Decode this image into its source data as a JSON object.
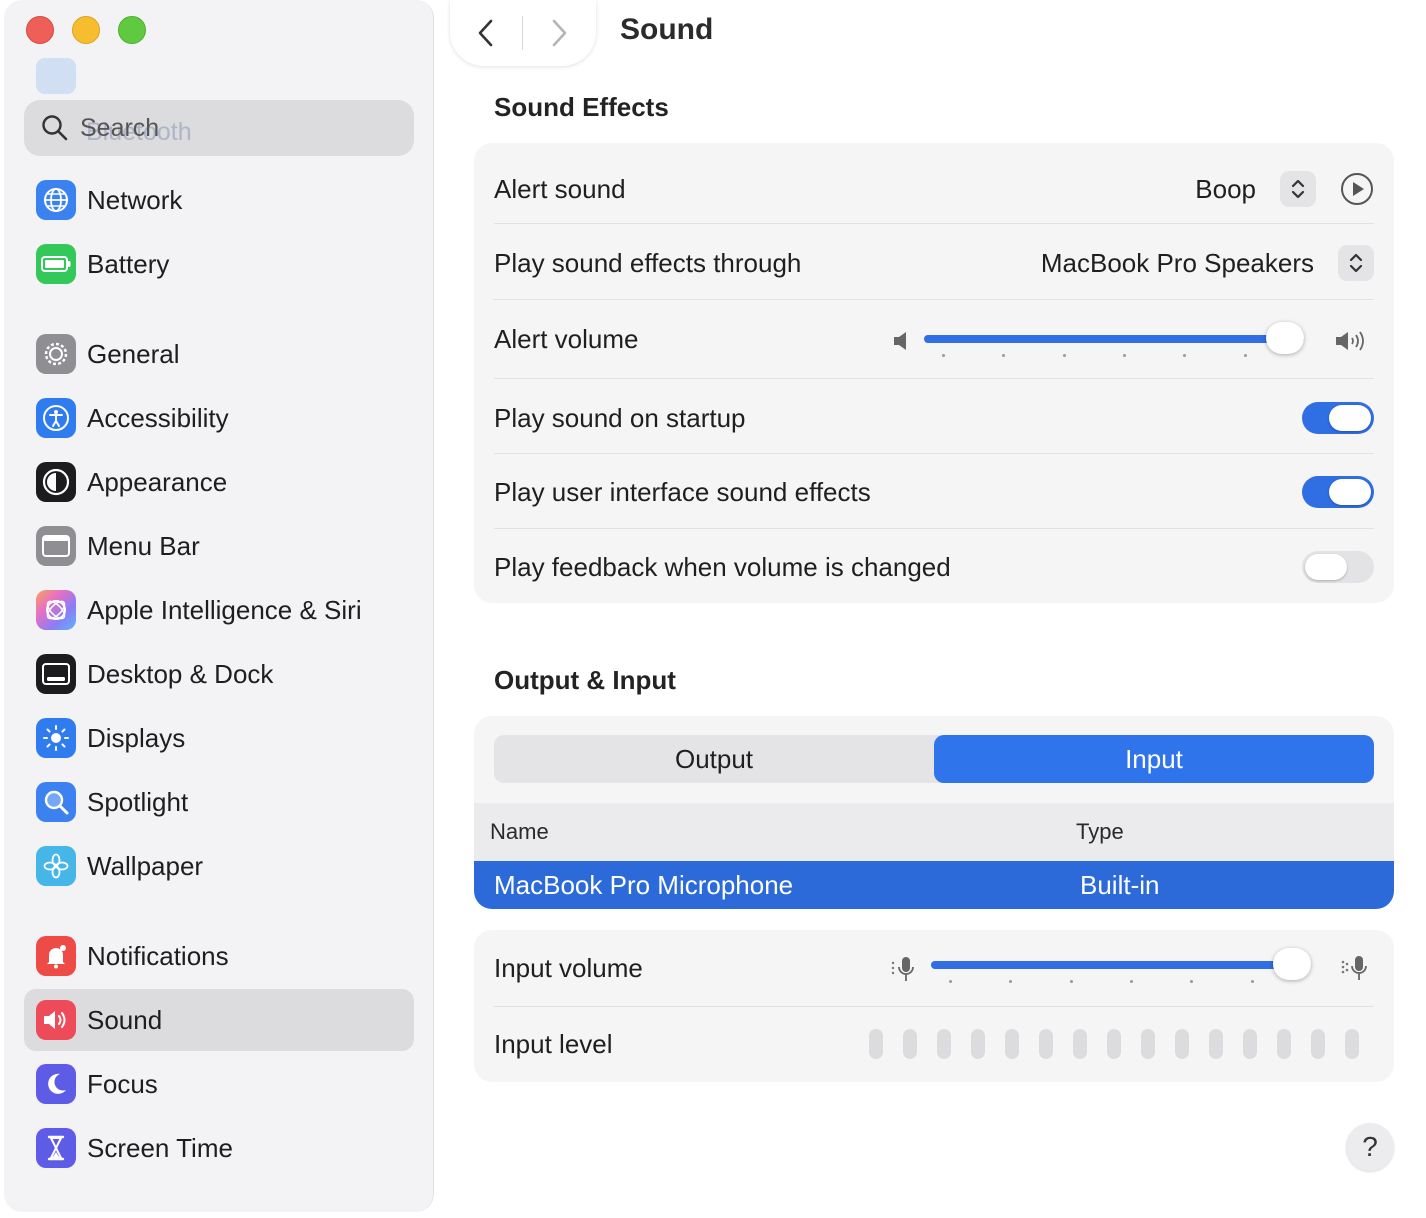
{
  "window": {
    "title": "Sound"
  },
  "sidebar": {
    "search_placeholder": "Search",
    "ghost_text": "Bluetooth",
    "items": [
      {
        "label": "Network",
        "icon": "globe-icon",
        "color": "#3b82f0",
        "active": false
      },
      {
        "label": "Battery",
        "icon": "battery-icon",
        "color": "#34c759",
        "active": false
      },
      {
        "label": "General",
        "icon": "gear-icon",
        "color": "#8e8e93",
        "active": false
      },
      {
        "label": "Accessibility",
        "icon": "accessibility-icon",
        "color": "#2f7bf0",
        "active": false
      },
      {
        "label": "Appearance",
        "icon": "appearance-icon",
        "color": "#1c1c1e",
        "active": false
      },
      {
        "label": "Menu Bar",
        "icon": "menubar-icon",
        "color": "#8e8e93",
        "active": false
      },
      {
        "label": "Apple Intelligence & Siri",
        "icon": "siri-icon",
        "color": "#e97bd0",
        "active": false
      },
      {
        "label": "Desktop & Dock",
        "icon": "dock-icon",
        "color": "#1c1c1e",
        "active": false
      },
      {
        "label": "Displays",
        "icon": "sun-icon",
        "color": "#2f7bf0",
        "active": false
      },
      {
        "label": "Spotlight",
        "icon": "magnifier-icon",
        "color": "#3b82f0",
        "active": false
      },
      {
        "label": "Wallpaper",
        "icon": "flower-icon",
        "color": "#44b6e8",
        "active": false
      },
      {
        "label": "Notifications",
        "icon": "bell-icon",
        "color": "#ee4b47",
        "active": false
      },
      {
        "label": "Sound",
        "icon": "speaker-icon",
        "color": "#ee4b5a",
        "active": true
      },
      {
        "label": "Focus",
        "icon": "moon-icon",
        "color": "#5e5ce6",
        "active": false
      },
      {
        "label": "Screen Time",
        "icon": "hourglass-icon",
        "color": "#5e5ce6",
        "active": false
      }
    ]
  },
  "sound_effects": {
    "title": "Sound Effects",
    "alert_sound": {
      "label": "Alert sound",
      "value": "Boop"
    },
    "play_through": {
      "label": "Play sound effects through",
      "value": "MacBook Pro Speakers"
    },
    "alert_volume": {
      "label": "Alert volume",
      "level": 1.0
    },
    "startup": {
      "label": "Play sound on startup",
      "on": true
    },
    "ui_effects": {
      "label": "Play user interface sound effects",
      "on": true
    },
    "feedback": {
      "label": "Play feedback when volume is changed",
      "on": false
    }
  },
  "output_input": {
    "title": "Output & Input",
    "tabs": [
      "Output",
      "Input"
    ],
    "selected_tab": "Input",
    "table": {
      "headers": [
        "Name",
        "Type"
      ],
      "rows": [
        {
          "name": "MacBook Pro Microphone",
          "type": "Built-in"
        }
      ]
    },
    "input_volume": {
      "label": "Input volume",
      "level": 1.0
    },
    "input_level": {
      "label": "Input level",
      "bars": 15,
      "lit": 0
    }
  },
  "help_label": "?",
  "colors": {
    "accent": "#2f6fe3",
    "selection": "#2c6ad9",
    "sidebar_bg": "#f3f3f5"
  }
}
